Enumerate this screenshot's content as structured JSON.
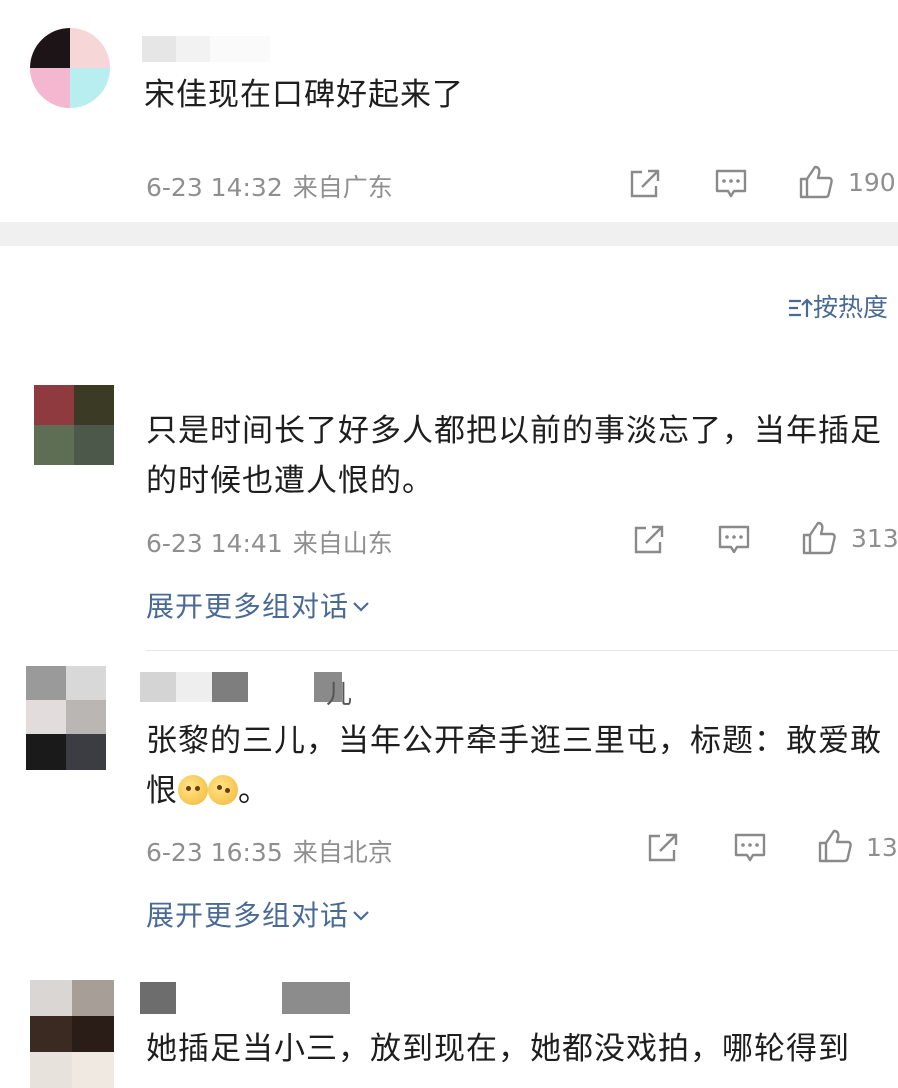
{
  "top_comment": {
    "text": "宋佳现在口碑好起来了",
    "time": "6-23 14:32",
    "location": "来自广东",
    "likes": "190"
  },
  "sort_label": "按热度",
  "comments": [
    {
      "text": "只是时间长了好多人都把以前的事淡忘了，当年插足的时候也遭人恨的。",
      "time": "6-23 14:41",
      "location": "来自山东",
      "likes": "313",
      "expand": "展开更多组对话"
    },
    {
      "username_visible": "儿",
      "text": "张黎的三儿，当年公开牵手逛三里屯，标题：敢爱敢恨",
      "text_tail": "。",
      "time": "6-23 16:35",
      "location": "来自北京",
      "likes": "13",
      "expand": "展开更多组对话"
    },
    {
      "text": "她插足当小三，放到现在，她都没戏拍，哪轮得到"
    }
  ],
  "icons": {
    "share": "share-icon",
    "comment": "comment-icon",
    "like": "thumbs-up-icon",
    "sort": "sort-icon",
    "expand": "chevron-down-icon"
  },
  "colors": {
    "link": "#4a6a96",
    "meta": "#8f8f8f",
    "divider": "#f0f0f0"
  }
}
